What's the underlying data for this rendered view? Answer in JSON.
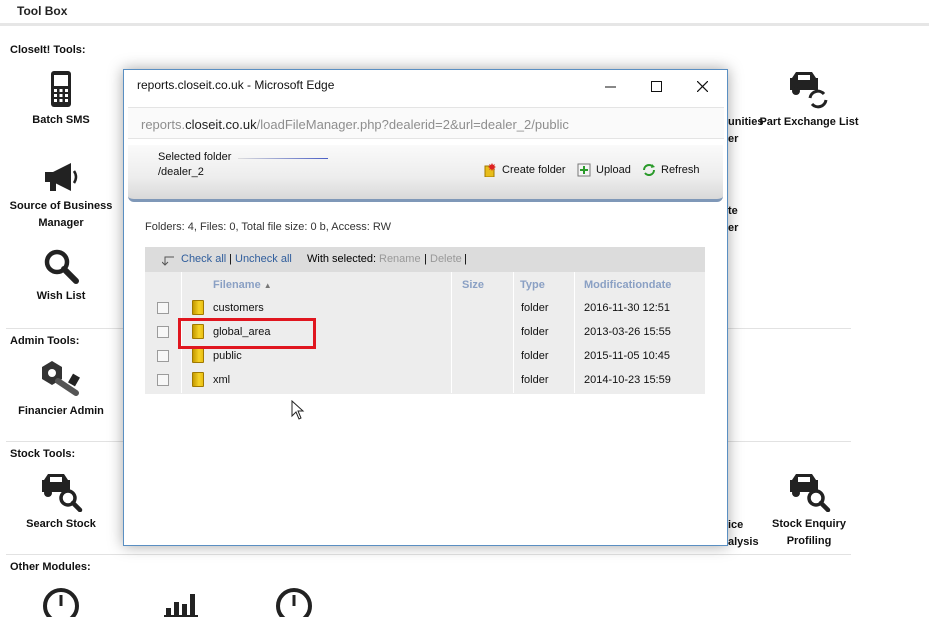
{
  "toolbox": {
    "title": "Tool Box",
    "sections": {
      "closeit": "CloseIt! Tools:",
      "admin": "Admin Tools:",
      "stock": "Stock Tools:",
      "other": "Other Modules:"
    },
    "tools": {
      "batch_sms": "Batch SMS",
      "source_manager": "Source of Business Manager",
      "wish_list": "Wish List",
      "financier_admin": "Financier Admin",
      "search_stock": "Search Stock",
      "part_exchange": "Part Exchange List",
      "stock_enquiry": "Stock Enquiry Profiling"
    },
    "partial_labels": {
      "unities": "unities",
      "er1": "er",
      "te": "te",
      "er2": "er",
      "ice": "ice",
      "alysis": "alysis"
    }
  },
  "popup": {
    "window_title": "reports.closeit.co.uk - Microsoft Edge",
    "url_prefix": "reports.",
    "url_domain": "closeit.co.uk",
    "url_path": "/loadFileManager.php?dealerid=2&url=dealer_2/public",
    "selected_folder_label": "Selected folder",
    "selected_folder_path": "/dealer_2",
    "buttons": {
      "create_folder": "Create folder",
      "upload": "Upload",
      "refresh": "Refresh"
    },
    "info": "Folders: 4, Files: 0, Total file size: 0 b, Access: RW",
    "actions": {
      "check_all": "Check all",
      "sep1": "|",
      "uncheck_all": "Uncheck all",
      "with_selected": "With selected:",
      "rename": "Rename",
      "sep2": "|",
      "delete": "Delete",
      "sep3": "|"
    },
    "columns": {
      "filename": "Filename",
      "size": "Size",
      "type": "Type",
      "modified": "Modificationdate"
    },
    "rows": [
      {
        "name": "customers",
        "size": "",
        "type": "folder",
        "date": "2016-11-30 12:51"
      },
      {
        "name": "global_area",
        "size": "",
        "type": "folder",
        "date": "2013-03-26 15:55"
      },
      {
        "name": "public",
        "size": "",
        "type": "folder",
        "date": "2015-11-05 10:45"
      },
      {
        "name": "xml",
        "size": "",
        "type": "folder",
        "date": "2014-10-23 15:59"
      }
    ],
    "highlight_color": "#e0161f"
  }
}
